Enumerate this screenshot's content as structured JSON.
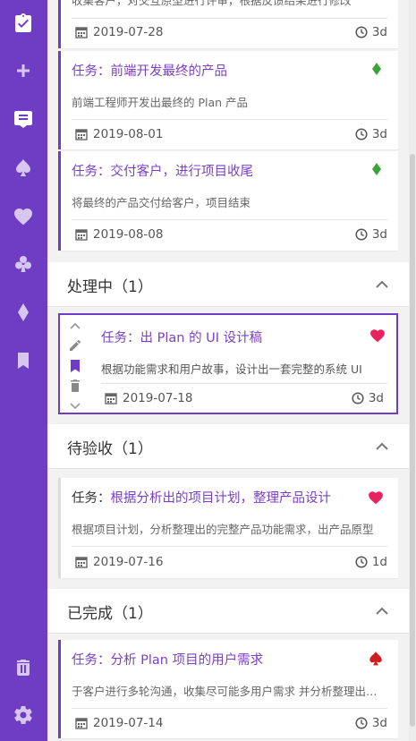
{
  "sidebar": {
    "icons": [
      "tasks-checklist-icon",
      "add-icon",
      "list-icon",
      "spade-icon",
      "heart-icon",
      "club-icon",
      "diamond-icon",
      "bookmark-icon",
      "trash-icon",
      "settings-icon"
    ]
  },
  "top_partial": {
    "desc": "收集客户，对交互原型进行评审，根据反馈结果进行修改",
    "date": "2019-07-28",
    "duration": "3d"
  },
  "todo_cards": [
    {
      "title": "任务：前端开发最终的产品",
      "desc": "前端工程师开发出最终的 Plan 产品",
      "date": "2019-08-01",
      "duration": "3d",
      "suit": "diamond",
      "suit_color": "#3aa33a"
    },
    {
      "title": "任务：交付客户，进行项目收尾",
      "desc": "将最终的产品交付给客户，项目结束",
      "date": "2019-08-08",
      "duration": "3d",
      "suit": "diamond",
      "suit_color": "#3aa33a"
    }
  ],
  "sections": {
    "processing": {
      "label": "处理中（1）"
    },
    "acceptance": {
      "label": "待验收（1）"
    },
    "done": {
      "label": "已完成（1）"
    }
  },
  "processing_card": {
    "title": "任务：出 Plan 的 UI 设计稿",
    "desc": "根据功能需求和用户故事，设计出一套完整的系统 UI",
    "date": "2019-07-18",
    "duration": "3d",
    "suit": "heart",
    "suit_color": "#e8245f"
  },
  "acceptance_card": {
    "title_prefix": "任务：",
    "title_main": "根据分析出的项目计划，整理产品设计",
    "desc": "根据项目计划，分析整理出的完整产品功能需求，出产品原型",
    "date": "2019-07-16",
    "duration": "1d",
    "suit": "heart",
    "suit_color": "#e8245f"
  },
  "done_card": {
    "title": "任务：分析 Plan 项目的用户需求",
    "desc": "于客户进行多轮沟通，收集尽可能多用户需求 并分析整理出功能需求",
    "date": "2019-07-14",
    "duration": "3d",
    "suit": "spade",
    "suit_color": "#cc1f1f"
  },
  "colors": {
    "accent": "#6f3cc4",
    "title": "#7b3fc4",
    "diamond": "#3aa33a",
    "heart": "#e8245f",
    "spade": "#cc1f1f"
  }
}
